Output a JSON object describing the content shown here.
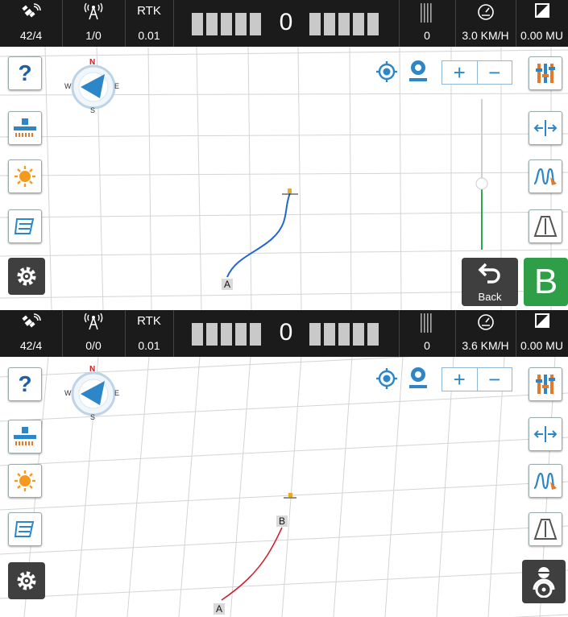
{
  "panels": [
    {
      "status": {
        "satellites": "42/4",
        "base": "1/0",
        "rtk_label": "RTK",
        "rtk_value": "0.01",
        "deviation": "0",
        "count": "0",
        "speed": "3.0 KM/H",
        "area": "0.00 MU"
      },
      "markers": {
        "a": "A"
      },
      "back_label": "Back",
      "b_label": "B"
    },
    {
      "status": {
        "satellites": "42/4",
        "base": "0/0",
        "rtk_label": "RTK",
        "rtk_value": "0.01",
        "deviation": "0",
        "count": "0",
        "speed": "3.6 KM/H",
        "area": "0.00 MU"
      },
      "markers": {
        "a": "A",
        "b": "B"
      }
    }
  ],
  "compass": {
    "n": "N",
    "s": "S",
    "e": "E",
    "w": "W"
  },
  "icons": {
    "status": [
      "satellite-icon",
      "base-station-icon",
      "signal-bars-icon",
      "speedometer-icon",
      "area-icon"
    ],
    "left_tools": [
      "help-icon",
      "implement-icon",
      "brightness-icon",
      "path-mode-icon",
      "settings-icon"
    ],
    "right_tools": [
      "equalizer-icon",
      "width-adjust-icon",
      "calibration-icon",
      "road-view-icon"
    ],
    "map_controls": [
      "locate-icon",
      "camera-follow-icon",
      "zoom-in-icon",
      "zoom-out-icon"
    ],
    "bottom_right": [
      "back-arrow-icon",
      "autosteer-driver-icon"
    ]
  },
  "colors": {
    "statusbar": "#1b1b1b",
    "accent_blue": "#2d86c8",
    "line_blue": "#2266cc",
    "line_red": "#cc2233",
    "b_button": "#2e9e47",
    "slider_green": "#2aa84a"
  }
}
